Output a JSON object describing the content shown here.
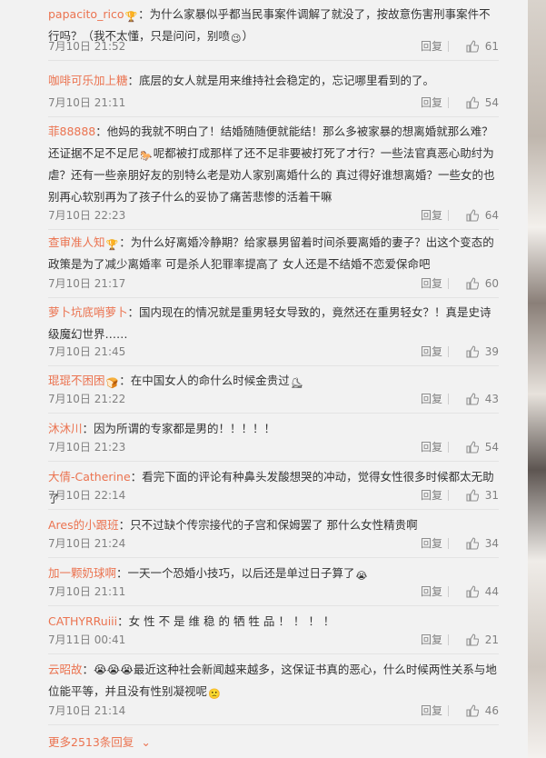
{
  "comments": [
    {
      "user": "papacito_rico",
      "emoji": "🏆",
      "text": "：为什么家暴似乎都当民事案件调解了就没了，按故意伤害刑事案件不行吗？（我不太懂，只是问问，别喷",
      "tail_emoji": "😉",
      "tail": "）",
      "time": "7月10日 21:52",
      "likes": "61"
    },
    {
      "user": "咖啡可乐加上糖",
      "emoji": "",
      "text": "：底层的女人就是用来维持社会稳定的，忘记哪里看到的了。",
      "tail_emoji": "",
      "tail": "",
      "time": "7月10日 21:11",
      "likes": "54"
    },
    {
      "user": "菲88888",
      "emoji": "",
      "text": "：他妈的我就不明白了！结婚随随便就能结！那么多被家暴的想离婚就那么难？还证据不足不足尼",
      "tail_emoji": "🐎",
      "tail": "呢都被打成那样了还不足非要被打死了才行？一些法官真恶心助纣为虐？还有一些亲朋好友的别特么老是劝人家别离婚什么的 真过得好谁想离婚？一些女的也别再心软别再为了孩子什么的妥协了痛苦悲惨的活着干嘛",
      "time": "7月10日 22:23",
      "likes": "64"
    },
    {
      "user": "查审准人知",
      "emoji": "🏆",
      "text": "：为什么好离婚冷静期？给家暴男留着时间杀要离婚的妻子？出这个变态的政策是为了减少离婚率 可是杀人犯罪率提高了 女人还是不结婚不恋爱保命吧",
      "tail_emoji": "",
      "tail": "",
      "time": "7月10日 21:17",
      "likes": "60"
    },
    {
      "user": "萝卜坑底哨萝卜",
      "emoji": "",
      "text": "：国内现在的情况就是重男轻女导致的，竟然还在重男轻女？！真是史诗级魔幻世界……",
      "tail_emoji": "",
      "tail": "",
      "time": "7月10日 21:45",
      "likes": "39"
    },
    {
      "user": "琨琨不困困",
      "emoji": "🍞",
      "text": "：在中国女人的命什么时候金贵过",
      "tail_emoji": "",
      "tail": "⛸",
      "time": "7月10日 21:22",
      "likes": "43"
    },
    {
      "user": "沐沐川",
      "emoji": "",
      "text": "：因为所谓的专家都是男的！！！！！",
      "tail_emoji": "",
      "tail": "",
      "time": "7月10日 21:23",
      "likes": "54"
    },
    {
      "user": "大倩-Catherine",
      "emoji": "",
      "text": "：看完下面的评论有种鼻头发酸想哭的冲动，觉得女性很多时候都太无助了",
      "tail_emoji": "",
      "tail": "",
      "time": "7月10日 22:14",
      "likes": "31"
    },
    {
      "user": "Ares的小跟班",
      "emoji": "",
      "text": "：只不过缺个传宗接代的子宫和保姆罢了 那什么女性精贵啊",
      "tail_emoji": "",
      "tail": "",
      "time": "7月10日 21:24",
      "likes": "34"
    },
    {
      "user": "加一颗奶球啊",
      "emoji": "",
      "text": "：一天一个恐婚小技巧，以后还是单过日子算了",
      "tail_emoji": "😭",
      "tail": "",
      "time": "7月10日 21:11",
      "likes": "44"
    },
    {
      "user": "CATHYRRuiii",
      "emoji": "",
      "text": "：女 性 不 是 维 稳 的 牺 牲 品 ！ ！ ！ ！",
      "tail_emoji": "",
      "tail": "",
      "time": "7月11日 00:41",
      "likes": "21"
    },
    {
      "user": "云昭故",
      "emoji": "",
      "text": "：😭😭😭最近这种社会新闻越来越多，这保证书真的恶心，什么时候两性关系与地位能平等，并且没有性别凝视呢",
      "tail_emoji": "🙁",
      "tail": "",
      "time": "7月10日 21:14",
      "likes": "46"
    }
  ],
  "reply_label": "回复",
  "more_label": "更多2513条回复",
  "colors": {
    "username": "#eb7350",
    "text": "#333333",
    "meta": "#808080"
  }
}
